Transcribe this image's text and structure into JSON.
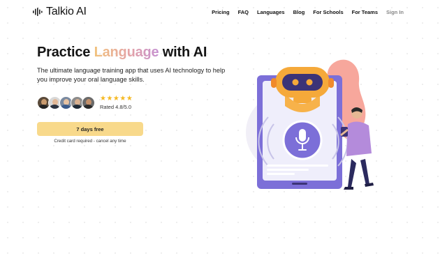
{
  "nav": {
    "brand": "Talkio AI",
    "links": [
      "Pricing",
      "FAQ",
      "Languages",
      "Blog",
      "For Schools",
      "For Teams"
    ],
    "signin": "Sign In"
  },
  "hero": {
    "title_prefix": "Practice ",
    "title_highlight": "Language",
    "title_suffix": " with AI",
    "description": "The ultimate language training app that uses AI technology to help you improve your oral language skills.",
    "stars": "★★★★★",
    "rating_text": "Rated 4.8/5.0",
    "cta_label": "7 days free",
    "cta_note": "Credit card required - cancel any time"
  },
  "icons": [
    "sound-wave-icon",
    "star-icon",
    "microphone-icon"
  ],
  "colors": {
    "accent": "#f8d98b",
    "star": "#f5b923",
    "tablet": "#7c6fd8",
    "robot": "#f5a93a",
    "person_shirt": "#b48bdb"
  }
}
